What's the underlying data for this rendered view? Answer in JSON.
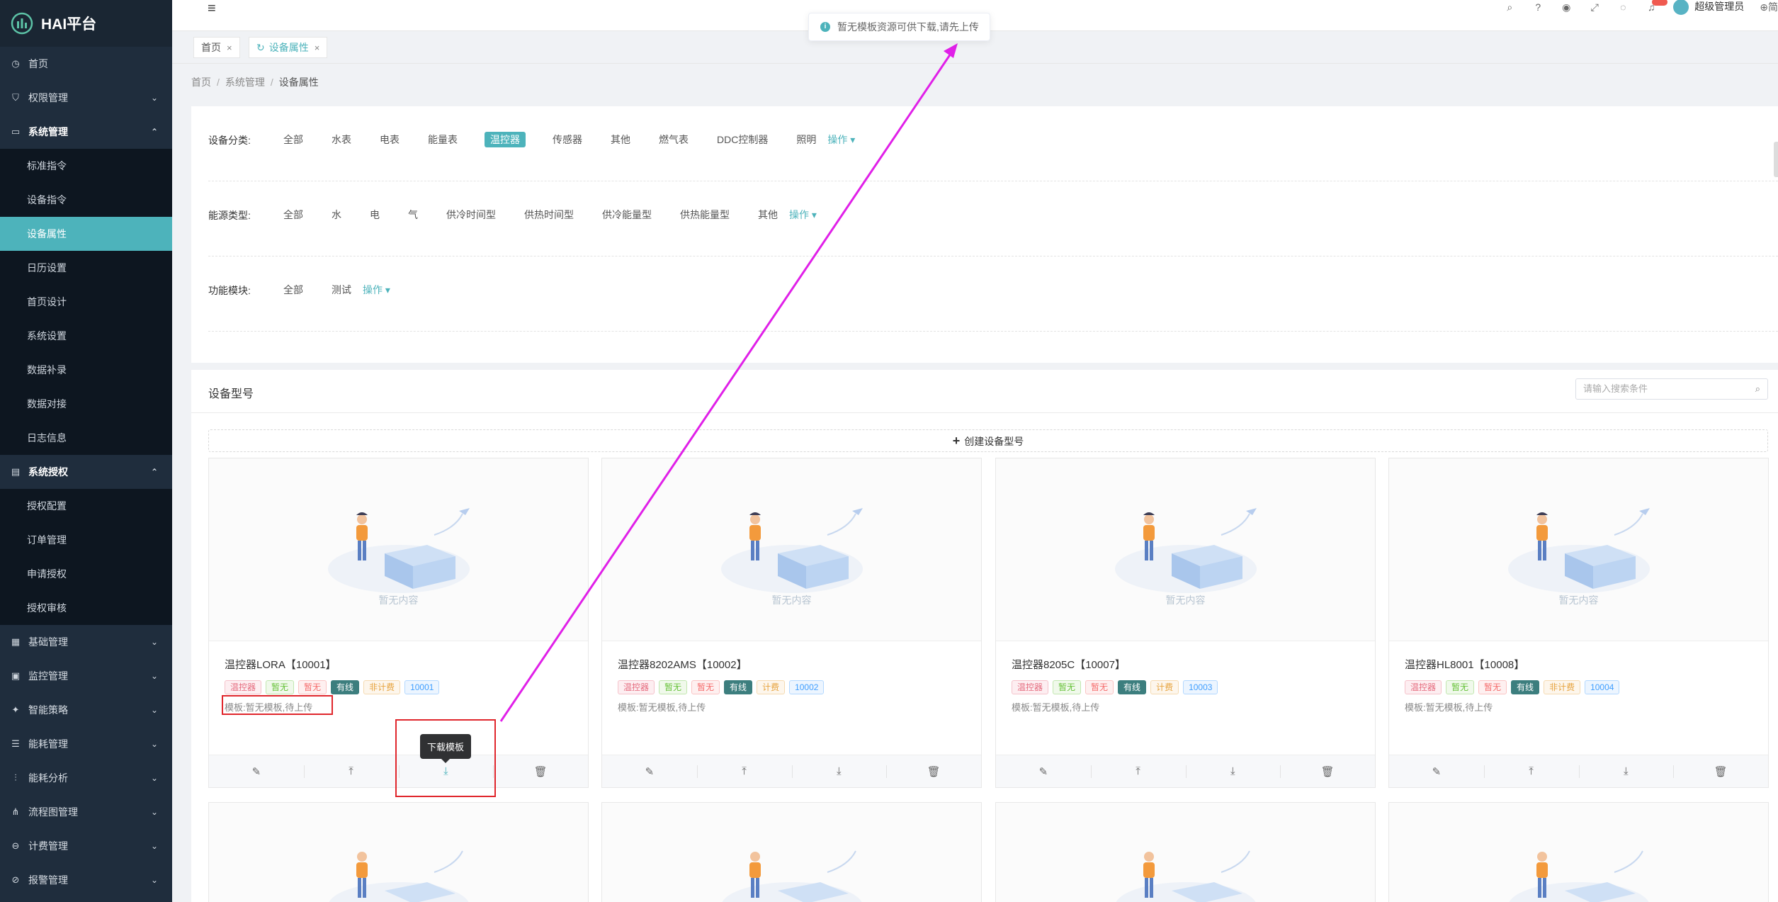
{
  "app": {
    "title": "HAI平台"
  },
  "sidebar": {
    "items": [
      {
        "label": "首页",
        "icon": "clock-icon",
        "expandable": false
      },
      {
        "label": "权限管理",
        "icon": "shield-icon",
        "expandable": true
      },
      {
        "label": "系统管理",
        "icon": "monitor-icon",
        "expandable": true,
        "open": true,
        "children": [
          "标准指令",
          "设备指令",
          "设备属性",
          "日历设置",
          "首页设计",
          "系统设置",
          "数据补录",
          "数据对接",
          "日志信息"
        ]
      },
      {
        "label": "系统授权",
        "icon": "document-icon",
        "expandable": true,
        "open": true,
        "children": [
          "授权配置",
          "订单管理",
          "申请授权",
          "授权审核"
        ]
      },
      {
        "label": "基础管理",
        "icon": "grid-icon",
        "expandable": true
      },
      {
        "label": "监控管理",
        "icon": "monitor-icon",
        "expandable": true
      },
      {
        "label": "智能策略",
        "icon": "bulb-icon",
        "expandable": true
      },
      {
        "label": "能耗管理",
        "icon": "sliders-icon",
        "expandable": true
      },
      {
        "label": "能耗分析",
        "icon": "chart-icon",
        "expandable": true
      },
      {
        "label": "流程图管理",
        "icon": "flow-icon",
        "expandable": true
      },
      {
        "label": "计费管理",
        "icon": "coin-icon",
        "expandable": true
      },
      {
        "label": "报警管理",
        "icon": "alarm-icon",
        "expandable": true
      }
    ],
    "active_child": "设备属性"
  },
  "header": {
    "user_name": "超级管理员",
    "lang_label": "简"
  },
  "tabs": [
    {
      "label": "首页",
      "active": false
    },
    {
      "label": "设备属性",
      "active": true
    }
  ],
  "breadcrumb": [
    "首页",
    "系统管理",
    "设备属性"
  ],
  "filters": [
    {
      "label": "设备分类:",
      "options": [
        "全部",
        "水表",
        "电表",
        "能量表",
        "温控器",
        "传感器",
        "其他",
        "燃气表",
        "DDC控制器",
        "照明"
      ],
      "selected": "温控器",
      "op_label": "操作 ▾"
    },
    {
      "label": "能源类型:",
      "options": [
        "全部",
        "水",
        "电",
        "气",
        "供冷时间型",
        "供热时间型",
        "供冷能量型",
        "供热能量型",
        "其他"
      ],
      "selected": "",
      "op_label": "操作 ▾"
    },
    {
      "label": "功能模块:",
      "options": [
        "全部",
        "测试"
      ],
      "selected": "",
      "op_label": "操作 ▾"
    }
  ],
  "models": {
    "title": "设备型号",
    "search_placeholder": "请输入搜索条件",
    "create_label": "创建设备型号",
    "empty_text": "暂无内容",
    "cards": [
      {
        "name": "温控器LORA【10001】",
        "tags": [
          "温控器",
          "暂无",
          "暂无",
          "有线",
          "非计费",
          "10001"
        ],
        "template": "模板:暂无模板,待上传"
      },
      {
        "name": "温控器8202AMS【10002】",
        "tags": [
          "温控器",
          "暂无",
          "暂无",
          "有线",
          "计费",
          "10002"
        ],
        "template": "模板:暂无模板,待上传"
      },
      {
        "name": "温控器8205C【10007】",
        "tags": [
          "温控器",
          "暂无",
          "暂无",
          "有线",
          "计费",
          "10003"
        ],
        "template": "模板:暂无模板,待上传"
      },
      {
        "name": "温控器HL8001【10008】",
        "tags": [
          "温控器",
          "暂无",
          "暂无",
          "有线",
          "非计费",
          "10004"
        ],
        "template": "模板:暂无模板,待上传"
      }
    ]
  },
  "toast": {
    "message": "暂无模板资源可供下载,请先上传"
  },
  "tooltip": {
    "text": "下载模板"
  },
  "colors": {
    "accent": "#4db3bb",
    "sidebar_bg": "#1f2d3d",
    "annotation_red": "#e0262c",
    "annotation_arrow": "#e020e8"
  }
}
